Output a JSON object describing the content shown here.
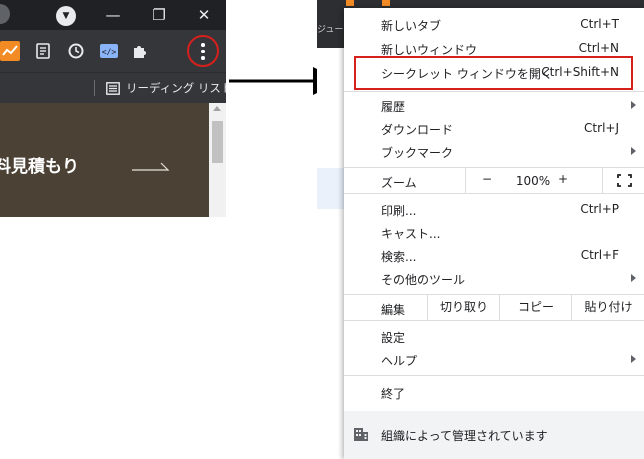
{
  "browser": {
    "reading_list_label": "リーディング リスト",
    "page_heading": "料見積もり",
    "win_minimize": "—",
    "win_maximize": "❐",
    "win_close": "✕",
    "extension_icons": [
      "orange-chart-icon",
      "notes-icon",
      "history-icon",
      "code-icon",
      "puzzle-icon"
    ]
  },
  "background": {
    "partial_text": "ジュール"
  },
  "menu": {
    "items_top": [
      {
        "label": "新しいタブ",
        "shortcut": "Ctrl+T"
      },
      {
        "label": "新しいウィンドウ",
        "shortcut": "Ctrl+N"
      },
      {
        "label": "シークレット ウィンドウを開く",
        "shortcut": "Ctrl+Shift+N"
      }
    ],
    "items_history": [
      {
        "label": "履歴",
        "submenu": true
      },
      {
        "label": "ダウンロード",
        "shortcut": "Ctrl+J"
      },
      {
        "label": "ブックマーク",
        "submenu": true
      }
    ],
    "zoom": {
      "label": "ズーム",
      "minus": "−",
      "value": "100%",
      "plus": "+"
    },
    "items_tools": [
      {
        "label": "印刷...",
        "shortcut": "Ctrl+P"
      },
      {
        "label": "キャスト..."
      },
      {
        "label": "検索...",
        "shortcut": "Ctrl+F"
      },
      {
        "label": "その他のツール",
        "submenu": true
      }
    ],
    "edit": {
      "label": "編集",
      "cut": "切り取り",
      "copy": "コピー",
      "paste": "貼り付け"
    },
    "items_settings": [
      {
        "label": "設定"
      },
      {
        "label": "ヘルプ",
        "submenu": true
      }
    ],
    "exit_label": "終了",
    "managed_label": "組織によって管理されています"
  },
  "colors": {
    "highlight": "#d6201c",
    "toolbar": "#35363a",
    "titlebar": "#202124"
  }
}
